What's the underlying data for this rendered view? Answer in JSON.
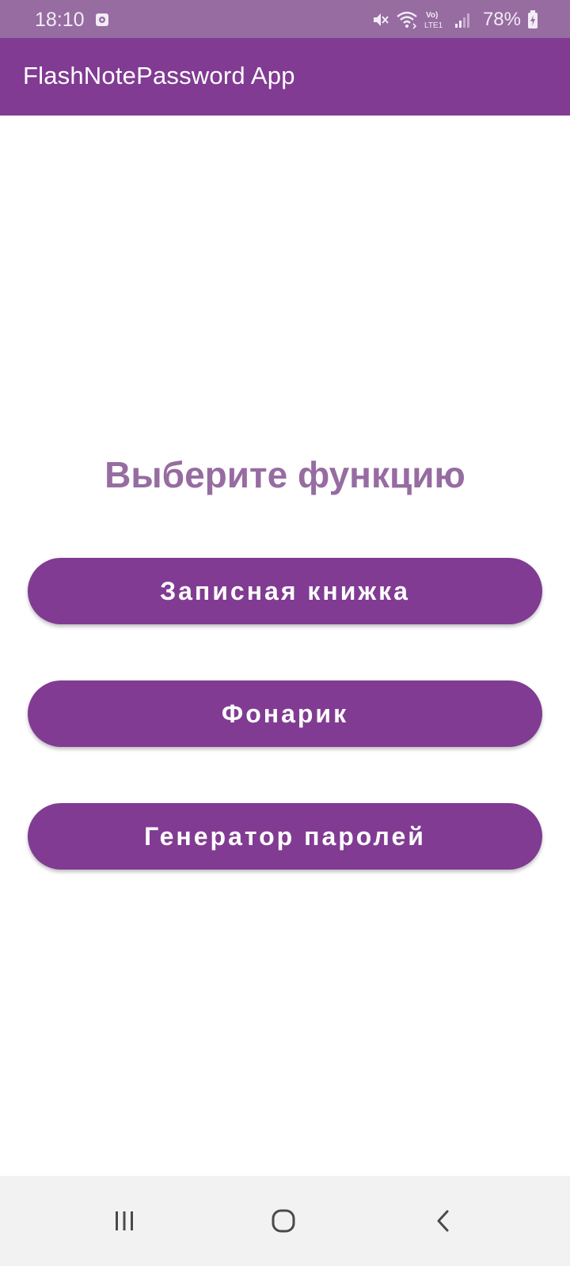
{
  "status_bar": {
    "time": "18:10",
    "battery_percent": "78%",
    "icons": [
      "notification-icon",
      "mute-icon",
      "wifi-icon",
      "volte-lte-icon",
      "signal-icon",
      "battery-charging-icon"
    ],
    "volte_label": "Vo)",
    "lte_label": "LTE1"
  },
  "app_bar": {
    "title": "FlashNotePassword App"
  },
  "main": {
    "heading": "Выберите функцию",
    "buttons": [
      {
        "label": "Записная книжка"
      },
      {
        "label": "Фонарик"
      },
      {
        "label": "Генератор паролей"
      }
    ]
  },
  "nav_bar": {
    "icons": [
      "recents-icon",
      "home-icon",
      "back-icon"
    ]
  },
  "colors": {
    "status_bar": "#966ca1",
    "app_bar": "#813b92",
    "accent": "#813b92",
    "heading": "#966ca1",
    "nav_bar": "#f2f2f2"
  }
}
